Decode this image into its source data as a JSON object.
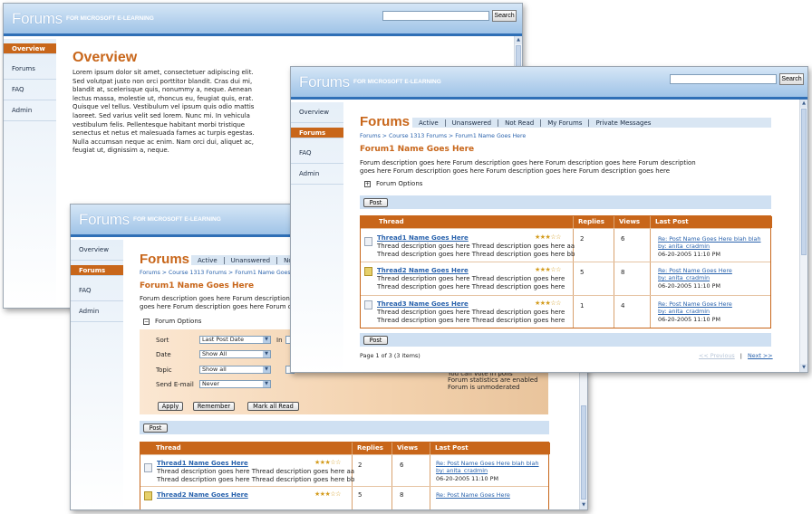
{
  "brand": {
    "logo": "Forums",
    "sub": "FOR MICROSOFT E-LEARNING",
    "search_button": "Search"
  },
  "sidebar": {
    "items": [
      "Overview",
      "Forums",
      "FAQ",
      "Admin"
    ]
  },
  "overview": {
    "title": "Overview",
    "lines": [
      "Lorem ipsum dolor sit amet, consectetuer adipiscing elit.",
      "Sed volutpat justo non orci porttitor blandit. Cras dui mi,",
      "blandit at, scelerisque quis, nonummy a, neque. Aenean",
      "lectus massa, molestie ut, rhoncus eu, feugiat quis, erat.",
      "Quisque vel tellus. Vestibulum vel ipsum quis odio mattis",
      "laoreet. Sed varius velit sed lorem. Nunc mi. In vehicula",
      "vestibulum felis. Pellentesque habitant morbi tristique",
      "senectus et netus et malesuada fames ac turpis egestas.",
      "Nulla accumsan neque ac enim. Nam orci dui, aliquet ac,",
      "feugiat ut, dignissim a, neque."
    ]
  },
  "forum_page": {
    "title": "Forums",
    "tabs": [
      "Active",
      "Unanswered",
      "Not Read",
      "My Forums",
      "Private Messages"
    ],
    "tabs_back_visible": [
      "Active",
      "Unanswered",
      "Not"
    ],
    "breadcrumb": "Forums > Course 1313 Forums > Forum1 Name Goes Here",
    "breadcrumb_cut": "Forums > Course 1313 Forums > Forum1 Name Goes",
    "forum_name": "Forum1 Name Goes Here",
    "desc_lines": [
      "Forum description goes here Forum description goes here Forum description goes here Forum description",
      "goes here Forum description goes here Forum description goes here Forum description goes here"
    ],
    "desc_cut_lines": [
      "Forum description goes here Forum description goes",
      "goes here Forum description goes here Forum descri"
    ],
    "forum_options": "Forum Options",
    "post_button": "Post",
    "columns": [
      "Thread",
      "Replies",
      "Views",
      "Last Post"
    ],
    "threads": [
      {
        "name": "Thread1 Name Goes Here",
        "desc1": "Thread description goes here Thread description goes here aa",
        "desc2": "Thread description goes here Thread description goes here bb",
        "rating": 3,
        "hot": false,
        "replies": "2",
        "views": "6",
        "last_title": "Re: Post Name Goes Here blah blah",
        "last_by": "by: anita_cradmin",
        "last_date": "06-20-2005 11:10 PM"
      },
      {
        "name": "Thread2 Name Goes Here",
        "desc1": "Thread description goes here Thread description goes here",
        "desc2": "Thread description goes here Thread description goes here",
        "rating": 3,
        "hot": true,
        "replies": "5",
        "views": "8",
        "last_title": "Re: Post Name Goes Here",
        "last_by": "by: anita_cradmin",
        "last_date": "06-20-2005 11:10 PM"
      },
      {
        "name": "Thread3 Name Goes Here",
        "desc1": "Thread description goes here Thread description goes here",
        "desc2": "Thread description goes here Thread description goes here",
        "rating": 3,
        "hot": false,
        "replies": "1",
        "views": "4",
        "last_title": "Re: Post Name Goes Here",
        "last_by": "by: anita_cradmin",
        "last_date": "06-20-2005 11:10 PM"
      }
    ],
    "pager_info": "Page 1 of 3 (3 items)",
    "pager_prev": "<< Previous",
    "pager_sep": "|",
    "pager_next": "Next >>"
  },
  "filters": {
    "sort_label": "Sort",
    "sort_value": "Last Post Date",
    "in_label": "In",
    "date_label": "Date",
    "date_value": "Show All",
    "topic_label": "Topic",
    "topic_value": "Show all",
    "email_label": "Send E-mail",
    "email_value": "Never",
    "notes": [
      "You can vote in polls",
      "Forum statistics are enabled",
      "Forum is unmoderated"
    ],
    "apply": "Apply",
    "remember": "Remember",
    "mark_all_read": "Mark all Read"
  }
}
